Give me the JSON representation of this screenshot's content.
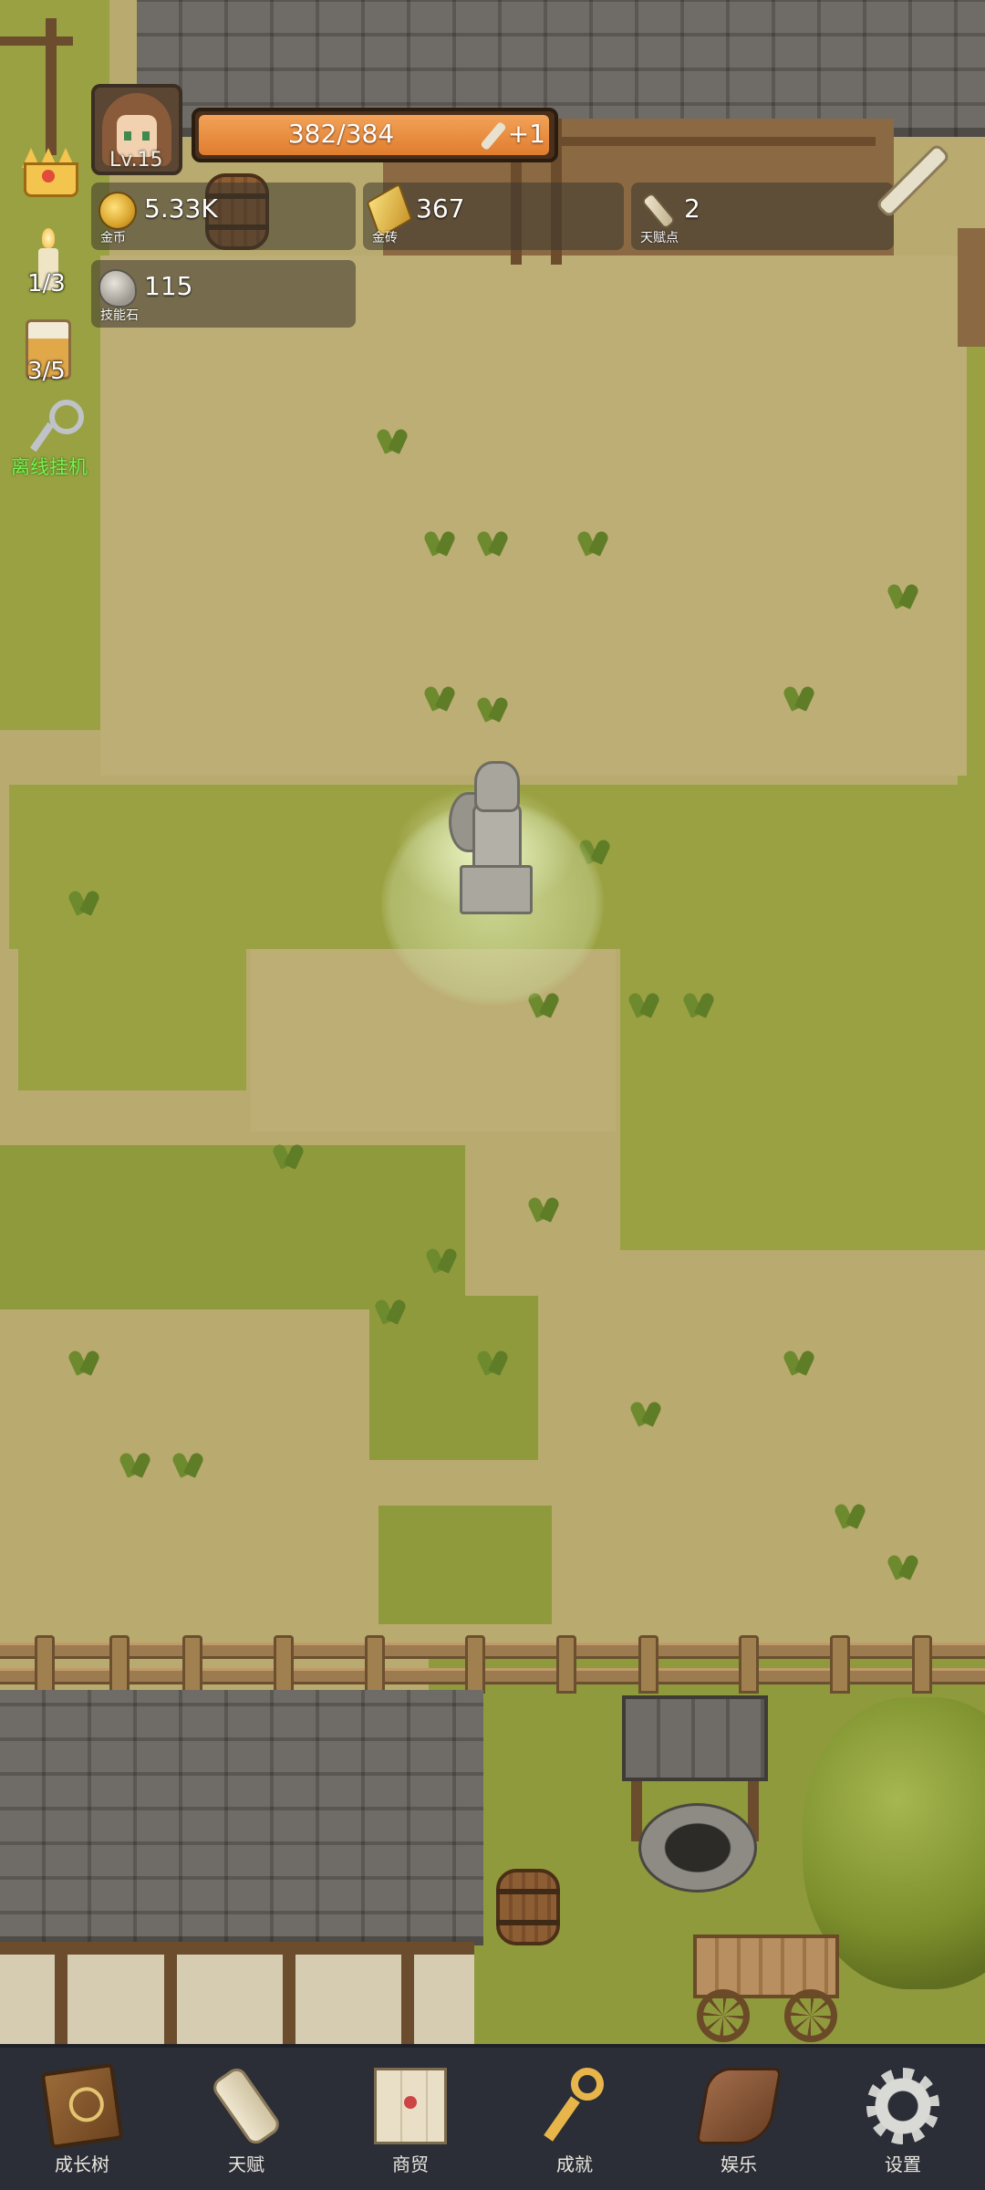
{
  "player": {
    "level": "Lv.15"
  },
  "health": {
    "text": "382/384",
    "bonus": "+1",
    "fill_fraction": 0.995
  },
  "resources": [
    {
      "value": "5.33K",
      "caption": "金币",
      "icon": "coin-icon"
    },
    {
      "value": "367",
      "caption": "金砖",
      "icon": "gold-bar-icon"
    },
    {
      "value": "2",
      "caption": "天赋点",
      "icon": "scroll-icon"
    },
    {
      "value": "115",
      "caption": "技能石",
      "icon": "skill-stone-icon"
    }
  ],
  "side": {
    "candle_count": "1/3",
    "beer_count": "3/5",
    "afk_label": "离线挂机"
  },
  "nav": [
    {
      "label": "成长树",
      "icon": "book-icon"
    },
    {
      "label": "天赋",
      "icon": "scroll-icon"
    },
    {
      "label": "商贸",
      "icon": "map-icon"
    },
    {
      "label": "成就",
      "icon": "key-icon"
    },
    {
      "label": "娱乐",
      "icon": "leather-icon"
    },
    {
      "label": "设置",
      "icon": "gear-icon"
    }
  ]
}
